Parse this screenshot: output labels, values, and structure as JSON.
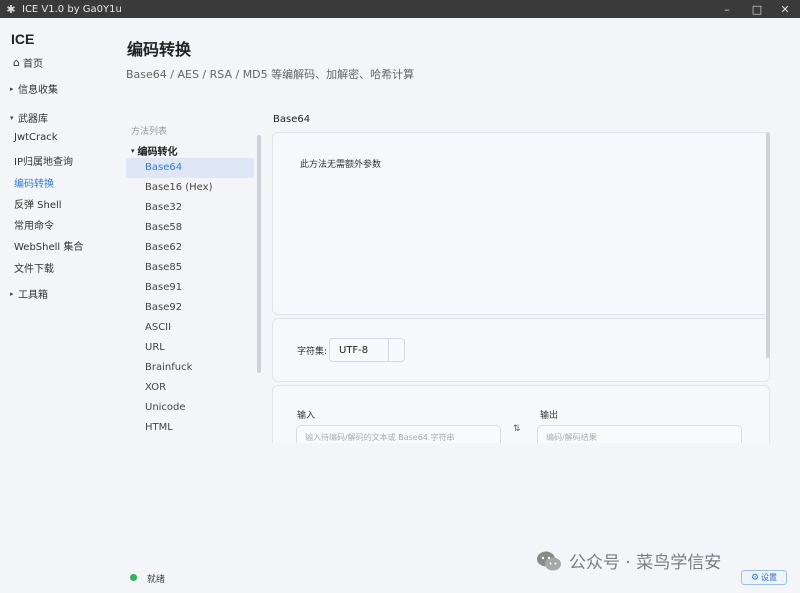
{
  "window": {
    "title": "ICE V1.0 by Ga0Y1u",
    "minimize": "–",
    "maximize": "□",
    "close": "✕"
  },
  "sidebar": {
    "brand": "ICE",
    "home": "首页",
    "info_gathering": "信息收集",
    "arsenal": "武器库",
    "arsenal_items": [
      "JwtCrack",
      "IP归属地查询",
      "编码转换",
      "反弹 Shell",
      "常用命令",
      "WebShell 集合",
      "文件下载"
    ],
    "active_item": "编码转换",
    "toolbox": "工具箱"
  },
  "header": {
    "title": "编码转换",
    "subtitle": "Base64 / AES / RSA / MD5 等编解码、加解密、哈希计算"
  },
  "methods": {
    "heading": "方法列表",
    "group": "编码转化",
    "items": [
      "Base64",
      "Base16 (Hex)",
      "Base32",
      "Base58",
      "Base62",
      "Base85",
      "Base91",
      "Base92",
      "ASCII",
      "URL",
      "Brainfuck",
      "XOR",
      "Unicode",
      "HTML"
    ],
    "active": "Base64"
  },
  "detail": {
    "title": "Base64",
    "no_params": "此方法无需额外参数",
    "charset_label": "字符集:",
    "charset_value": "UTF-8",
    "input_label": "输入",
    "input_placeholder": "输入待编码/解码的文本或 Base64 字符串",
    "output_label": "输出",
    "output_placeholder": "编码/解码结果",
    "swap_symbol": "⇅"
  },
  "status": {
    "text": "就绪",
    "dot_color": "#2fb552"
  },
  "watermark": "公众号 · 菜鸟学信安",
  "settings_label": "设置",
  "colors": {
    "accent": "#2f7de1",
    "active_bg": "#dfe7f7"
  }
}
